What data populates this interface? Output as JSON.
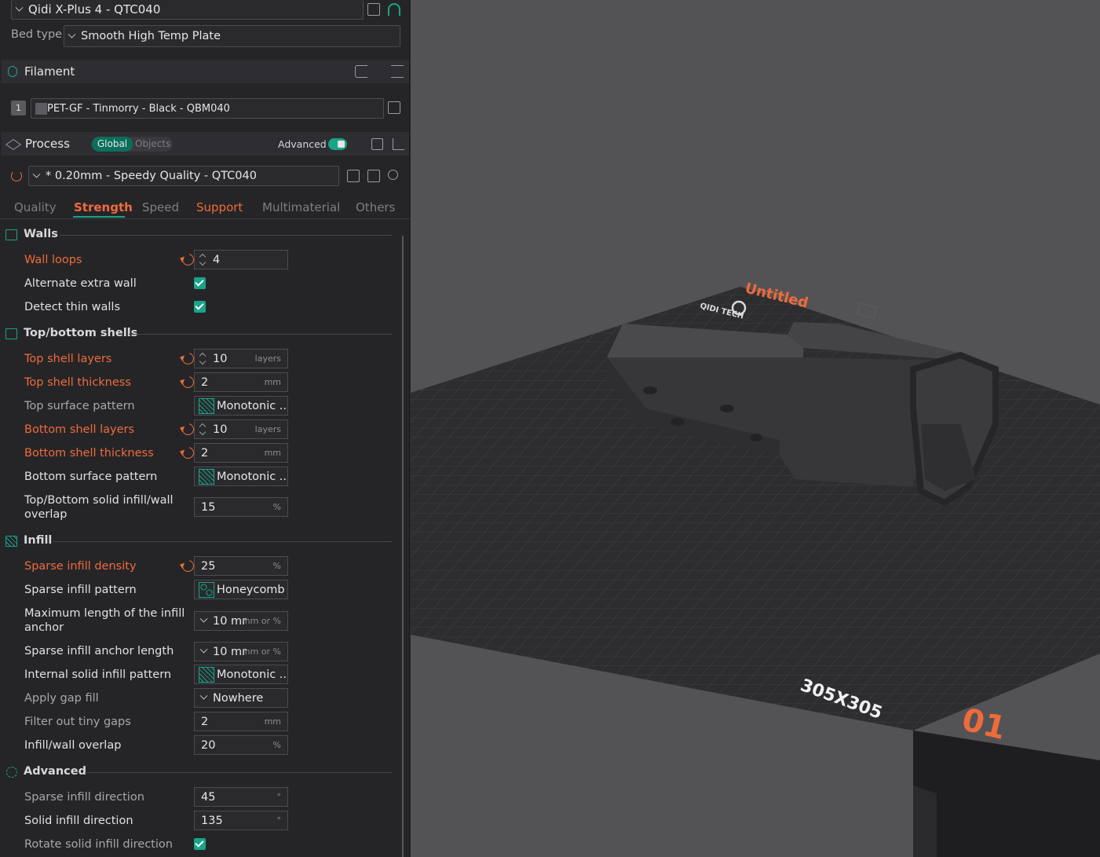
{
  "printer": {
    "name": "Qidi X-Plus 4 - QTC040"
  },
  "bed": {
    "label": "Bed type",
    "value": "Smooth High Temp Plate"
  },
  "filament": {
    "header": "Filament",
    "slot_number": "1",
    "name": "PET-GF - Tinmorry - Black - QBM040"
  },
  "process": {
    "header": "Process",
    "scope_global": "Global",
    "scope_objects": "Objects",
    "advanced_label": "Advanced",
    "preset": "* 0.20mm - Speedy Quality - QTC040"
  },
  "tabs": [
    "Quality",
    "Strength",
    "Speed",
    "Support",
    "Multimaterial",
    "Others"
  ],
  "groups": {
    "walls": "Walls",
    "shells": "Top/bottom shells",
    "infill": "Infill",
    "advanced": "Advanced"
  },
  "settings": {
    "wall_loops": {
      "label": "Wall loops",
      "value": "4"
    },
    "alternate_extra_wall": {
      "label": "Alternate extra wall"
    },
    "detect_thin_walls": {
      "label": "Detect thin walls"
    },
    "top_shell_layers": {
      "label": "Top shell layers",
      "value": "10",
      "unit": "layers"
    },
    "top_shell_thickness": {
      "label": "Top shell thickness",
      "value": "2",
      "unit": "mm"
    },
    "top_surface_pattern": {
      "label": "Top surface pattern",
      "value": "Monotonic ..."
    },
    "bottom_shell_layers": {
      "label": "Bottom shell layers",
      "value": "10",
      "unit": "layers"
    },
    "bottom_shell_thickness": {
      "label": "Bottom shell thickness",
      "value": "2",
      "unit": "mm"
    },
    "bottom_surface_pattern": {
      "label": "Bottom surface pattern",
      "value": "Monotonic ..."
    },
    "solid_infill_overlap": {
      "label_line1": "Top/Bottom solid infill/wall",
      "label_line2": "overlap",
      "value": "15",
      "unit": "%"
    },
    "sparse_infill_density": {
      "label": "Sparse infill density",
      "value": "25",
      "unit": "%"
    },
    "sparse_infill_pattern": {
      "label": "Sparse infill pattern",
      "value": "Honeycomb"
    },
    "max_anchor_length": {
      "label_line1": "Maximum length of the infill",
      "label_line2": "anchor",
      "value": "10 mr",
      "unit": "mm or %"
    },
    "anchor_length": {
      "label": "Sparse infill anchor length",
      "value": "10 mr",
      "unit": "mm or %"
    },
    "internal_solid_pattern": {
      "label": "Internal solid infill pattern",
      "value": "Monotonic ..."
    },
    "gap_fill": {
      "label": "Apply gap fill",
      "value": "Nowhere"
    },
    "filter_gaps": {
      "label": "Filter out tiny gaps",
      "value": "2",
      "unit": "mm"
    },
    "infill_wall_overlap": {
      "label": "Infill/wall overlap",
      "value": "20",
      "unit": "%"
    },
    "sparse_direction": {
      "label": "Sparse infill direction",
      "value": "45",
      "unit": "°"
    },
    "solid_direction": {
      "label": "Solid infill direction",
      "value": "135",
      "unit": "°"
    },
    "rotate_solid": {
      "label": "Rotate solid infill direction"
    }
  },
  "viewport": {
    "plate_name": "Untitled",
    "brand": "QIDI TECH",
    "bed_size": "305X305",
    "plate_number": "01"
  }
}
